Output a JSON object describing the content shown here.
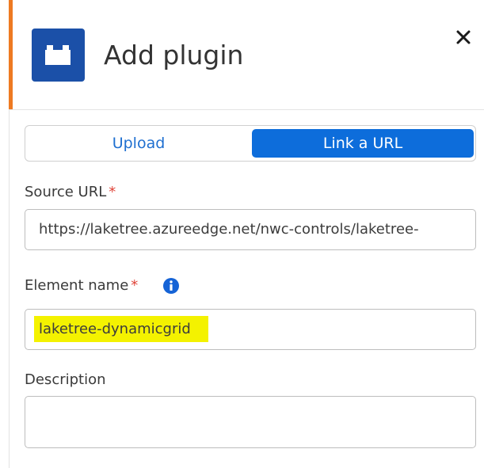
{
  "dialog": {
    "title": "Add plugin",
    "icon": "plugin-block-icon",
    "close_icon": "close-icon",
    "accent_color": "#ee7a22",
    "icon_bg_color": "#1b50a8"
  },
  "tabs": [
    {
      "label": "Upload",
      "selected": false
    },
    {
      "label": "Link a URL",
      "selected": true
    }
  ],
  "tab_accent_color": "#0d6ddb",
  "fields": {
    "source_url": {
      "label": "Source URL",
      "required_marker": "*",
      "value": "https://laketree.azureedge.net/nwc-controls/laketree-"
    },
    "element_name": {
      "label": "Element name",
      "required_marker": "*",
      "info_icon": "info-icon",
      "value": "laketree-dynamicgrid",
      "highlight_color": "#f4f200"
    },
    "description": {
      "label": "Description",
      "value": ""
    }
  }
}
